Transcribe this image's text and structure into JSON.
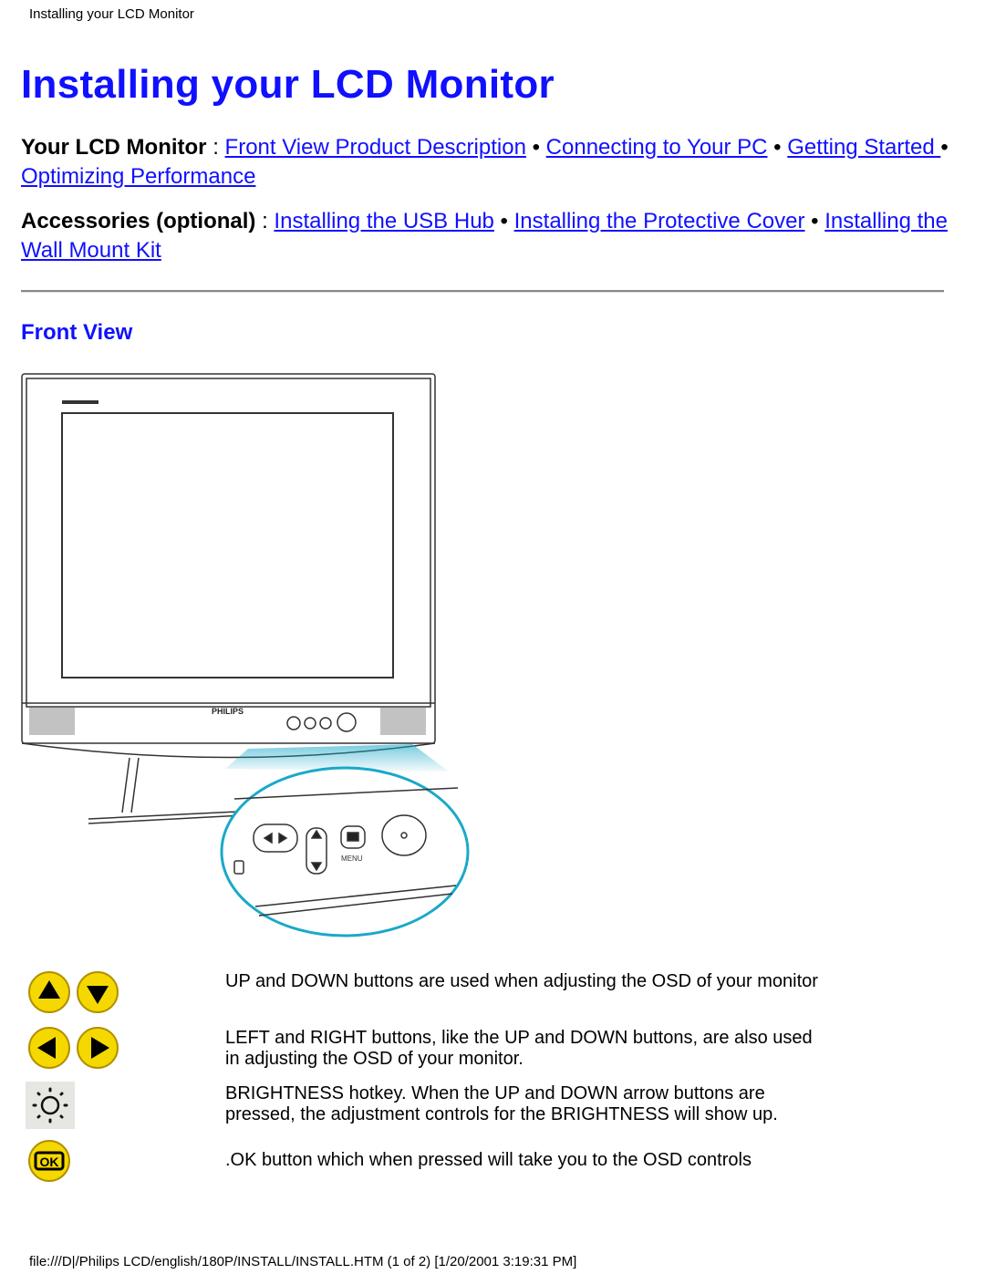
{
  "header": {
    "title": "Installing your LCD Monitor"
  },
  "page_title": "Installing your LCD Monitor",
  "nav_lcd": {
    "label": "Your LCD Monitor",
    "sep": " : ",
    "links": [
      "Front View Product Description",
      "Connecting to Your PC",
      "Getting Started ",
      "Optimizing Performance"
    ],
    "bullet": " • "
  },
  "nav_acc": {
    "label": "Accessories (optional)",
    "sep": " : ",
    "links": [
      "Installing the USB Hub",
      "Installing the Protective Cover",
      "Installing the Wall Mount Kit"
    ],
    "bullet": " • "
  },
  "section": {
    "title": "Front View"
  },
  "illustration": {
    "brand_logo": "PHILIPS",
    "menu_label": "MENU",
    "accent_color": "#19a9c8"
  },
  "buttons": [
    {
      "icons": [
        "up-arrow",
        "down-arrow"
      ],
      "text": "UP and DOWN buttons are used when adjusting the OSD of your monitor"
    },
    {
      "icons": [
        "left-arrow",
        "right-arrow"
      ],
      "text": "LEFT and RIGHT buttons, like the UP and DOWN buttons, are also used in adjusting the OSD of your monitor."
    },
    {
      "icons": [
        "brightness"
      ],
      "text": "BRIGHTNESS hotkey. When the UP and DOWN arrow buttons are pressed, the adjustment controls for the BRIGHTNESS will show up."
    },
    {
      "icons": [
        "ok"
      ],
      "text": ".OK button which when pressed will take you to the OSD controls"
    }
  ],
  "colors": {
    "link": "#1010ff",
    "button_yellow": "#f5d800"
  },
  "footer": {
    "text": "file:///D|/Philips LCD/english/180P/INSTALL/INSTALL.HTM (1 of 2) [1/20/2001 3:19:31 PM]"
  }
}
